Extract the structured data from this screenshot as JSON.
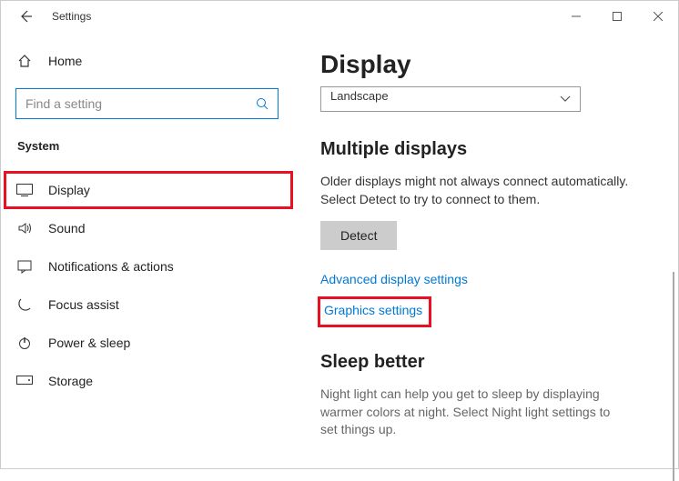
{
  "titlebar": {
    "app_name": "Settings"
  },
  "sidebar": {
    "home_label": "Home",
    "search_placeholder": "Find a setting",
    "section_label": "System",
    "items": [
      {
        "label": "Display"
      },
      {
        "label": "Sound"
      },
      {
        "label": "Notifications & actions"
      },
      {
        "label": "Focus assist"
      },
      {
        "label": "Power & sleep"
      },
      {
        "label": "Storage"
      }
    ]
  },
  "main": {
    "title": "Display",
    "orientation_value": "Landscape",
    "multiple_heading": "Multiple displays",
    "multiple_body": "Older displays might not always connect automatically. Select Detect to try to connect to them.",
    "detect_label": "Detect",
    "adv_link": "Advanced display settings",
    "gfx_link": "Graphics settings",
    "sleep_heading": "Sleep better",
    "sleep_body": "Night light can help you get to sleep by displaying warmer colors at night. Select Night light settings to set things up."
  }
}
